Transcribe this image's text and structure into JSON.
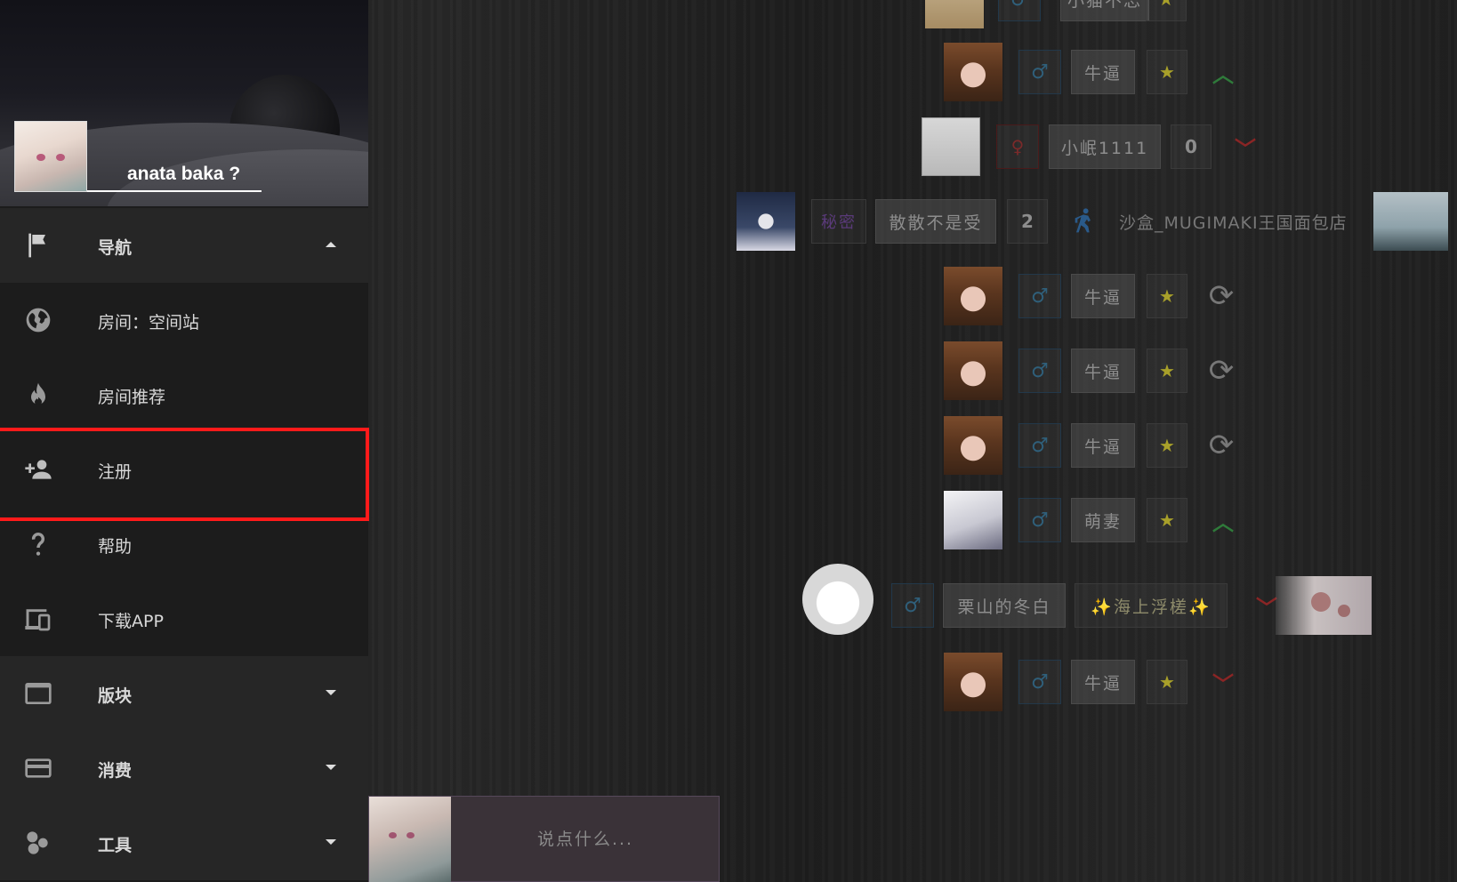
{
  "sidebar": {
    "username": "anata baka ?",
    "nav_items": [
      {
        "label": "导航",
        "icon": "flag-icon",
        "group": true,
        "caret": "up"
      },
      {
        "label": "房间：空间站",
        "icon": "globe-icon"
      },
      {
        "label": "房间推荐",
        "icon": "fire-icon"
      },
      {
        "label": "注册",
        "icon": "person-add-icon"
      },
      {
        "label": "帮助",
        "icon": "question-icon"
      },
      {
        "label": "下载APP",
        "icon": "devices-icon"
      },
      {
        "label": "版块",
        "icon": "window-icon",
        "group": true,
        "caret": "down"
      },
      {
        "label": "消费",
        "icon": "credit-card-icon",
        "group": true,
        "caret": "down"
      },
      {
        "label": "工具",
        "icon": "bubbles-icon",
        "group": true,
        "caret": "down"
      }
    ]
  },
  "chat": {
    "placeholder": "说点什么..."
  },
  "users": [
    {
      "name": "小猫不忘",
      "gender": "♂",
      "status": "star",
      "arrow": ""
    },
    {
      "name": "牛逼",
      "gender": "♂",
      "star": "★",
      "status": "up"
    },
    {
      "name": "小岷1111",
      "gender": "♀",
      "count": "0",
      "status": "down"
    },
    {
      "tag": "秘密",
      "name": "散散不是受",
      "count": "2",
      "status": "walk",
      "room": "沙盒_MUGIMAKI王国面包店"
    },
    {
      "name": "牛逼",
      "gender": "♂",
      "star": "★",
      "status": "refresh"
    },
    {
      "name": "牛逼",
      "gender": "♂",
      "star": "★",
      "status": "refresh"
    },
    {
      "name": "牛逼",
      "gender": "♂",
      "star": "★",
      "status": "refresh"
    },
    {
      "name": "萌妻",
      "gender": "♂",
      "star": "★",
      "status": "up"
    },
    {
      "name": "栗山的冬白",
      "gender": "♂",
      "title": "✨海上浮槎✨",
      "status": "down"
    },
    {
      "name": "牛逼",
      "gender": "♂",
      "star": "★",
      "status": "down"
    }
  ],
  "colors": {
    "highlight": "#ff1a1a",
    "male": "#2f5f7a",
    "female": "#7a2a2a",
    "star": "#a8a02a",
    "up": "#2f7a3a",
    "down": "#8a2525"
  }
}
